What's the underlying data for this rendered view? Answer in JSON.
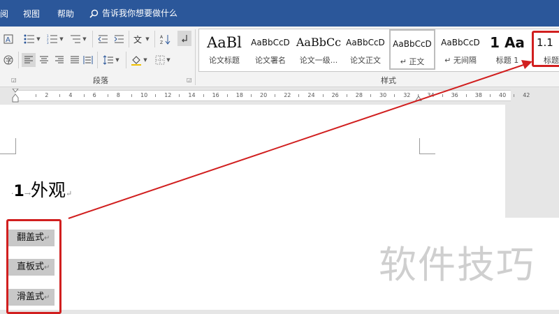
{
  "menu": {
    "tabs": [
      {
        "label": "阅"
      },
      {
        "label": "视图"
      },
      {
        "label": "帮助"
      }
    ],
    "search_prompt": "告诉我你想要做什么"
  },
  "ribbon": {
    "groups": {
      "paragraph": "段落",
      "styles": "样式"
    },
    "style_gallery": [
      {
        "preview": "AaBl",
        "name": "论文标题"
      },
      {
        "preview": "AaBbCcD",
        "name": "论文署名"
      },
      {
        "preview": "AaBbCc",
        "name": "论文一级..."
      },
      {
        "preview": "AaBbCcD",
        "name": "论文正文"
      },
      {
        "preview": "AaBbCcD",
        "name": "↵ 正文",
        "selected": true
      },
      {
        "preview": "AaBbCcD",
        "name": "↵ 无间隔"
      },
      {
        "preview": "1 Aa",
        "name": "标题 1"
      },
      {
        "preview": "1.1",
        "name": "标题"
      }
    ]
  },
  "ruler": {
    "labels": [
      "2",
      "4",
      "6",
      "8",
      "10",
      "12",
      "14",
      "16",
      "18",
      "20",
      "22",
      "24",
      "26",
      "28",
      "30",
      "32",
      "34",
      "36",
      "38",
      "40",
      "42"
    ]
  },
  "document": {
    "heading": {
      "number": "1",
      "text": "外观"
    },
    "list_items": [
      "翻盖式",
      "直板式",
      "滑盖式"
    ],
    "paragraph_mark": "↵"
  },
  "watermark": "软件技巧",
  "colors": {
    "title_bar": "#2b579a",
    "annotation": "#d11f1f",
    "selection": "#c8c8c8"
  }
}
